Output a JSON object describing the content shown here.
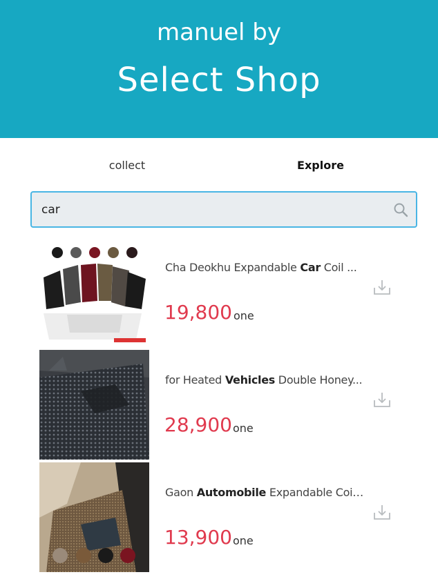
{
  "header": {
    "subtitle": "manuel by",
    "title": "Select Shop",
    "bg_color": "#17a8c2"
  },
  "tabs": [
    {
      "label": "collect",
      "active": false
    },
    {
      "label": "Explore",
      "active": true
    }
  ],
  "search": {
    "value": "car",
    "placeholder": "",
    "icon": "search-icon"
  },
  "products": [
    {
      "name_pre": "Cha Deokhu Expandable ",
      "name_bold": "Car",
      "name_post": " Coil ...",
      "price": "19,800",
      "unit": "one",
      "image": "car-coil-mat-set",
      "icon": "download-icon"
    },
    {
      "name_pre": "for Heated ",
      "name_bold": "Vehicles",
      "name_post": " Double Honey...",
      "price": "28,900",
      "unit": "one",
      "image": "honeycomb-car-mat",
      "icon": "download-icon"
    },
    {
      "name_pre": "Gaon ",
      "name_bold": "Automobile",
      "name_post": " Expandable Coil ...",
      "price": "13,900",
      "unit": "one",
      "image": "car-interior-coil-mat",
      "icon": "download-icon"
    }
  ],
  "colors": {
    "price": "#e03a4e",
    "search_border": "#48b5e4",
    "search_bg": "#e9edf0"
  }
}
